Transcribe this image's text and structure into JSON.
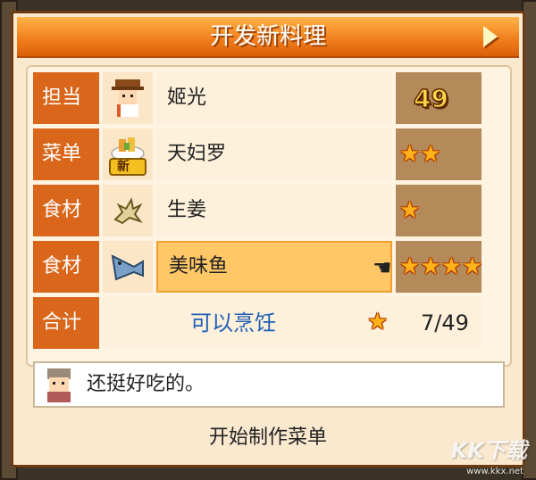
{
  "dialog": {
    "title": "开发新料理"
  },
  "rows": [
    {
      "label": "担当",
      "icon": "chef-portrait-icon",
      "name": "姬光",
      "level": "49"
    },
    {
      "label": "菜单",
      "icon": "tempura-dish-icon",
      "badge": "新",
      "name": "天妇罗",
      "stars": 2
    },
    {
      "label": "食材",
      "icon": "ginger-icon",
      "name": "生姜",
      "stars": 1
    },
    {
      "label": "食材",
      "icon": "fish-icon",
      "name": "美味鱼",
      "stars": 4
    }
  ],
  "total": {
    "label": "合计",
    "status": "可以烹饪",
    "count": "7/49"
  },
  "comment": {
    "text": "还挺好吃的。"
  },
  "footer": {
    "action": "开始制作菜单"
  },
  "watermark": {
    "main": "KK下载",
    "sub": "www.kkx.net"
  },
  "colors": {
    "header": "#f07c1a",
    "label_bg": "#d9661a",
    "status": "#1f5fb5",
    "star": "#ffb21a"
  }
}
